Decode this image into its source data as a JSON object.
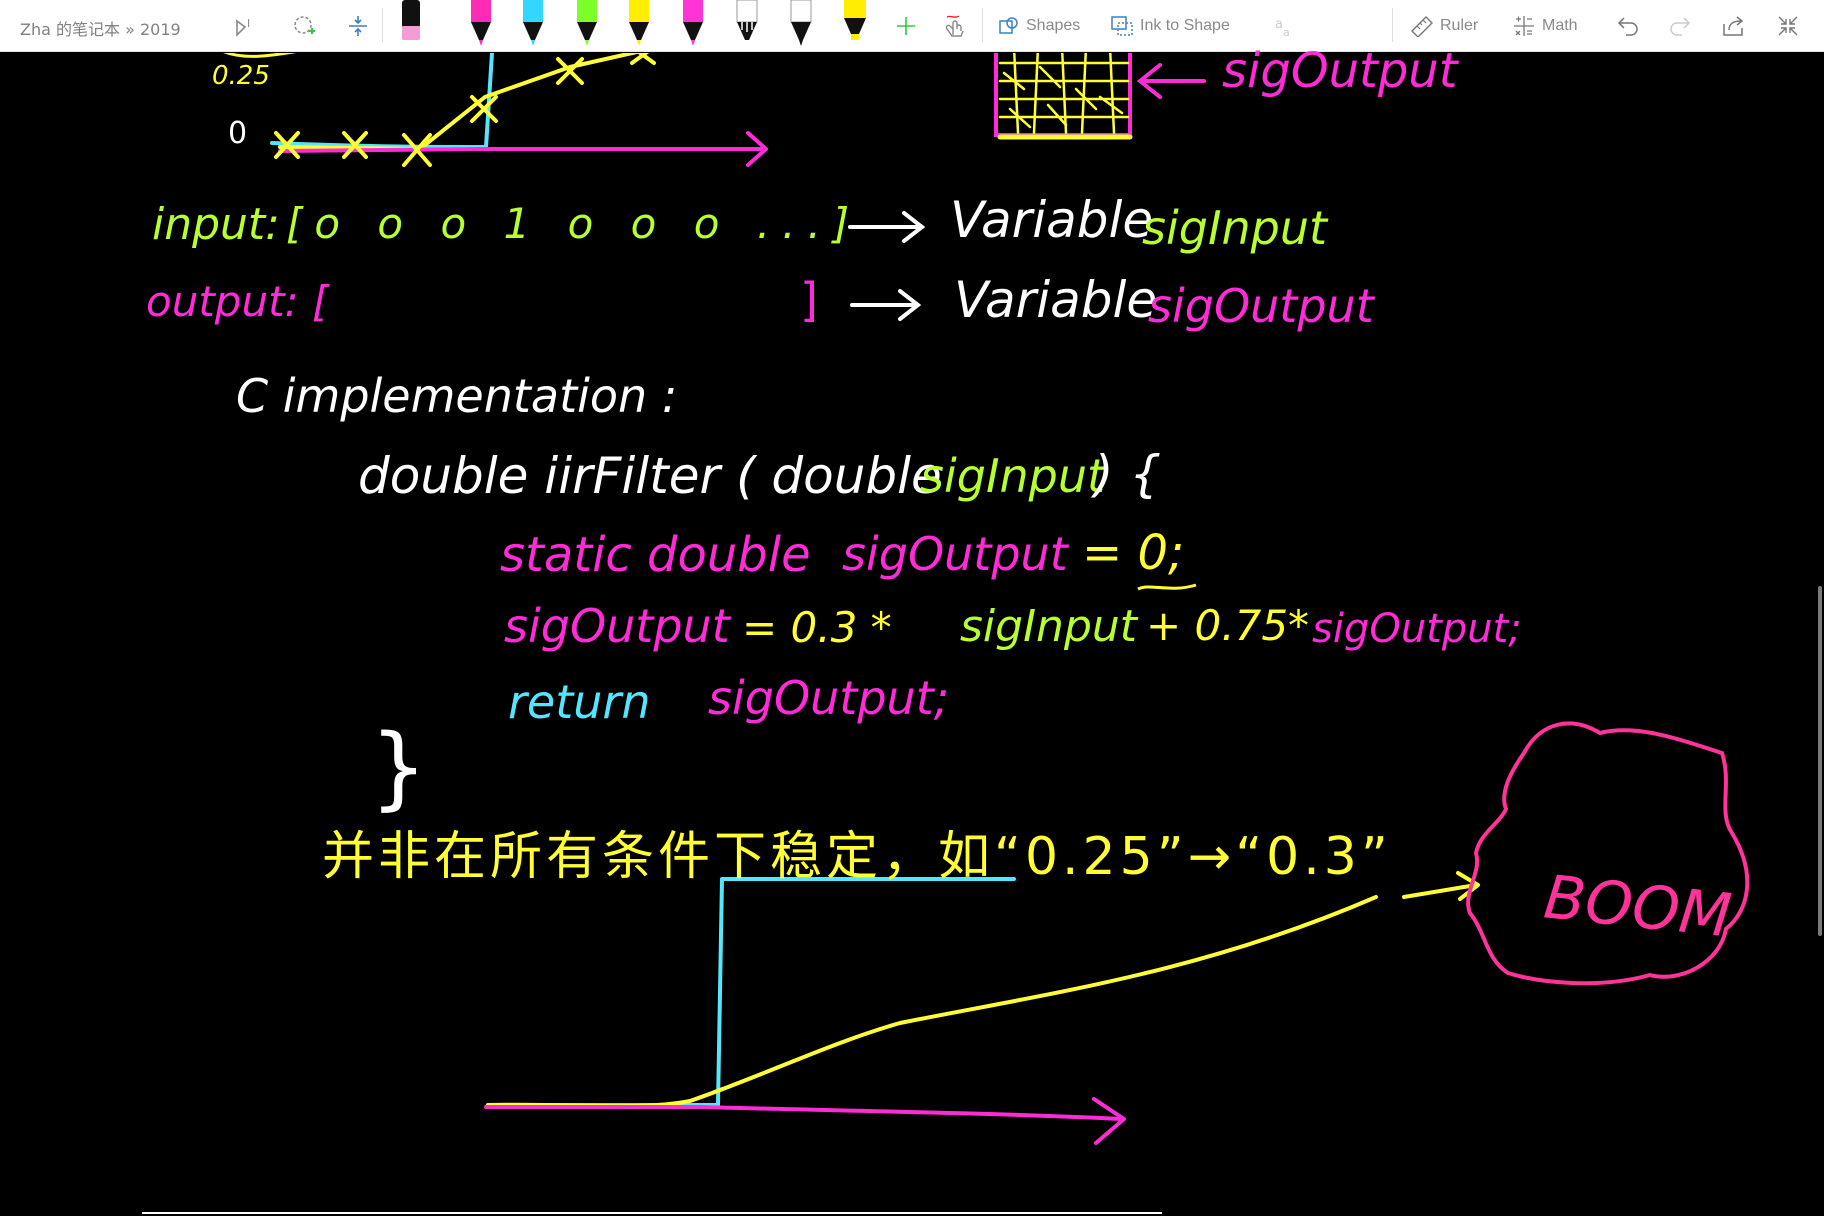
{
  "notebook_title": "Zha 的笔记本 » 2019",
  "toolbar": {
    "shapes_label": "Shapes",
    "ink_to_shape_label": "Ink to Shape",
    "ruler_label": "Ruler",
    "math_label": "Math"
  },
  "colors": {
    "yellow": "#ffff33",
    "magenta": "#ff2bd6",
    "cyan": "#55e6ff",
    "green": "#b8ff2f",
    "white": "#ffffff",
    "pink": "#ff3399"
  },
  "graph_top": {
    "y_tick_025": "0.25",
    "y_tick_0": "0"
  },
  "buffer_label": "sigOutput",
  "input_row": {
    "label": "input:",
    "values": "[o o o 1 o o o ...]",
    "arrow_text": "→ Variable",
    "var": "sigInput"
  },
  "output_row": {
    "label": "output: [",
    "close": "]",
    "arrow_text": "→ Variable",
    "var": "sigOutput"
  },
  "code": {
    "heading": "C implementation :",
    "sig_line_a": "double iirFilter ( double",
    "sig_line_var": "sigInput",
    "sig_line_b": ") {",
    "static_kw": "static double",
    "static_var": "sigOutput",
    "static_init": "= 0;",
    "assign_lhs": "sigOutput",
    "assign_eq": "= 0.3 *",
    "assign_in": "sigInput",
    "assign_plus": "+ 0.75*",
    "assign_out": "sigOutput;",
    "return_kw": "return",
    "return_var": "sigOutput;",
    "close_brace": "}"
  },
  "note": "并非在所有条件下稳定，如“0.25”→“0.3”",
  "boom": "BOOM"
}
